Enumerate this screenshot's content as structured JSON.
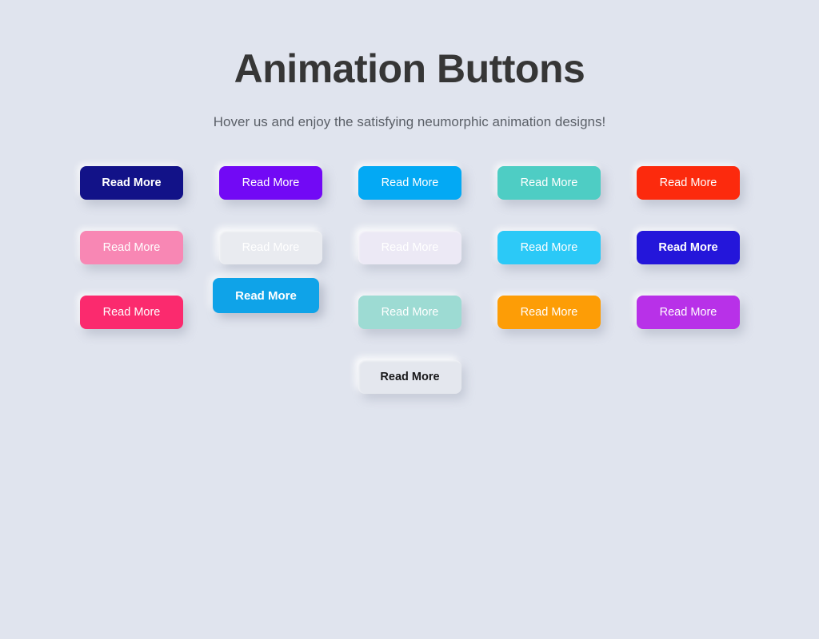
{
  "page": {
    "background_color": "#e0e4ee",
    "title": "Animation Buttons",
    "subtitle": "Hover us and enjoy the satisfying neumorphic animation designs!",
    "title_color": "#363636",
    "subtitle_color": "#5b6068"
  },
  "buttons": {
    "label": "Read More",
    "rows": [
      {
        "row_index": 1,
        "cells": [
          {
            "present": true,
            "label": "Read More",
            "bg": "#121288",
            "text_color": "#ffffff",
            "style": "flat-soft bold-label"
          },
          {
            "present": true,
            "label": "Read More",
            "bg": "#7209f5",
            "text_color": "#ffffff",
            "style": "flat-soft"
          },
          {
            "present": true,
            "label": "Read More",
            "bg": "#03a9f4",
            "text_color": "#ffffff",
            "style": "flat-soft"
          },
          {
            "present": true,
            "label": "Read More",
            "bg": "#4ecdc4",
            "text_color": "#ffffff",
            "style": "flat-soft"
          },
          {
            "present": true,
            "label": "Read More",
            "bg": "#fc2a0d",
            "text_color": "#ffffff",
            "style": "flat-soft"
          }
        ]
      },
      {
        "row_index": 2,
        "cells": [
          {
            "present": true,
            "label": "Read More",
            "bg": "#f887b4",
            "text_color": "#ffffff",
            "style": "flat-soft"
          },
          {
            "present": true,
            "label": "Read More",
            "bg": "#e9ebf0",
            "text_color": "#ffffff",
            "style": "inset-light"
          },
          {
            "present": true,
            "label": "Read More",
            "bg": "#ece9f5",
            "text_color": "#ffffff",
            "style": "inset-light"
          },
          {
            "present": true,
            "label": "Read More",
            "bg": "#2bc9f7",
            "text_color": "#ffffff",
            "style": "flat-soft"
          },
          {
            "present": true,
            "label": "Read More",
            "bg": "#2416da",
            "text_color": "#ffffff",
            "style": "flat-soft bold-label"
          }
        ]
      },
      {
        "row_index": 3,
        "cells": [
          {
            "present": true,
            "label": "Read More",
            "bg": "#fb2a6e",
            "text_color": "#ffffff",
            "style": "flat-soft"
          },
          {
            "present": true,
            "label": "Read More",
            "bg": "#0fa3e8",
            "text_color": "#ffffff",
            "style": "raised bold-label"
          },
          {
            "present": true,
            "label": "Read More",
            "bg": "#9ddbd3",
            "text_color": "#ffffff",
            "style": "flat-soft"
          },
          {
            "present": true,
            "label": "Read More",
            "bg": "#fd9d06",
            "text_color": "#ffffff",
            "style": "flat-soft"
          },
          {
            "present": true,
            "label": "Read More",
            "bg": "#b831e8",
            "text_color": "#ffffff",
            "style": "flat-soft"
          }
        ]
      },
      {
        "row_index": 4,
        "cells": [
          {
            "present": false
          },
          {
            "present": false
          },
          {
            "present": true,
            "label": "Read More",
            "bg": "#e4e7ee",
            "text_color": "#18181a",
            "style": "inset-light dark-label bold-label"
          },
          {
            "present": false
          },
          {
            "present": false
          }
        ]
      }
    ]
  }
}
